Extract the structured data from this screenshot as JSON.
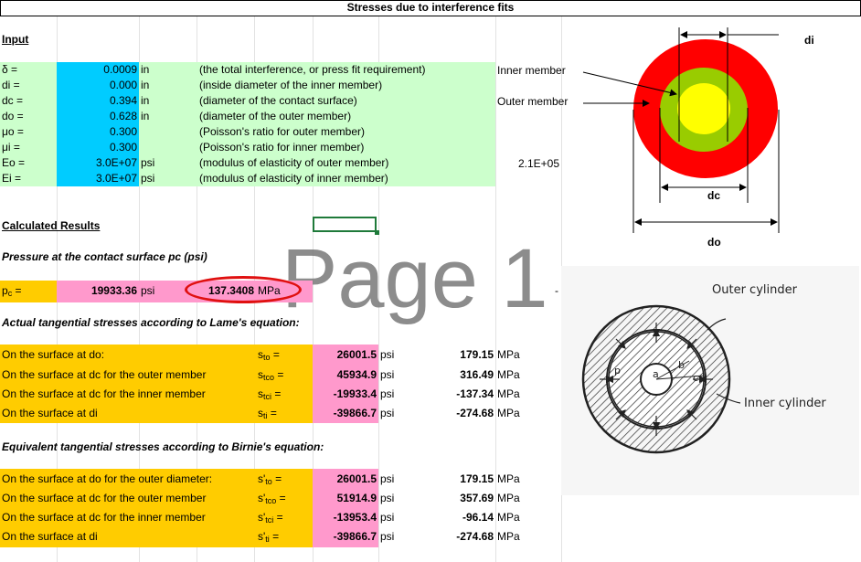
{
  "title": "Stresses due to interference fits",
  "watermark": "Page 1",
  "input": {
    "heading": "Input",
    "rows": [
      {
        "label": "δ =",
        "value": "0.0009",
        "unit": "in",
        "desc": "(the total interference, or press fit requirement)"
      },
      {
        "label": "di =",
        "value": "0.000",
        "unit": "in",
        "desc": "(inside diameter of the inner member)"
      },
      {
        "label": "dc =",
        "value": "0.394",
        "unit": "in",
        "desc": "(diameter of the contact surface)"
      },
      {
        "label": "do =",
        "value": "0.628",
        "unit": "in",
        "desc": "(diameter of the outer member)"
      },
      {
        "label": "μo =",
        "value": "0.300",
        "unit": "",
        "desc": "(Poisson's ratio for outer member)"
      },
      {
        "label": "μi =",
        "value": "0.300",
        "unit": "",
        "desc": "(Poisson's ratio for inner member)"
      },
      {
        "label": "Eo =",
        "value": "3.0E+07",
        "unit": "psi",
        "desc": "(modulus of elasticity of outer member)"
      },
      {
        "label": "Ei =",
        "value": "3.0E+07",
        "unit": "psi",
        "desc": "(modulus of elasticity of inner member)"
      }
    ],
    "inner_member_label": "Inner member",
    "outer_member_label": "Outer member",
    "extra_value": "2.1E+05"
  },
  "calculated": {
    "heading": "Calculated Results",
    "pressure_heading": "Pressure at the contact surface pc (psi)",
    "pc_label_main": "p",
    "pc_label_sub": "c",
    "pc_label_tail": " =",
    "pc_psi": "19933.36",
    "pc_psi_unit": "psi",
    "pc_mpa": "137.3408",
    "pc_mpa_unit": "MPa",
    "dash": "-"
  },
  "lame": {
    "heading": "Actual tangential stresses according to Lame's equation:",
    "rows": [
      {
        "desc": "On the surface at do:",
        "sym": "s",
        "sub": "to",
        "val": "26001.5",
        "unit": "psi",
        "mpa": "179.15",
        "mpa_unit": "MPa"
      },
      {
        "desc": "On the surface at dc for the outer member",
        "sym": "s",
        "sub": "tco",
        "val": "45934.9",
        "unit": "psi",
        "mpa": "316.49",
        "mpa_unit": "MPa"
      },
      {
        "desc": "On the surface at dc for the inner member",
        "sym": "s",
        "sub": "tci",
        "val": "-19933.4",
        "unit": "psi",
        "mpa": "-137.34",
        "mpa_unit": "MPa"
      },
      {
        "desc": "On the surface at di",
        "sym": "s",
        "sub": "ti",
        "val": "-39866.7",
        "unit": "psi",
        "mpa": "-274.68",
        "mpa_unit": "MPa"
      }
    ]
  },
  "birnie": {
    "heading": "Equivalent tangential stresses according to Birnie's equation:",
    "rows": [
      {
        "desc": "On the surface at do for the outer diameter:",
        "sym": "s'",
        "sub": "to",
        "val": "26001.5",
        "unit": "psi",
        "mpa": "179.15",
        "mpa_unit": "MPa"
      },
      {
        "desc": "On the surface at dc for the outer member",
        "sym": "s'",
        "sub": "tco",
        "val": "51914.9",
        "unit": "psi",
        "mpa": "357.69",
        "mpa_unit": "MPa"
      },
      {
        "desc": "On the surface at dc for the inner member",
        "sym": "s'",
        "sub": "tci",
        "val": "-13953.4",
        "unit": "psi",
        "mpa": "-96.14",
        "mpa_unit": "MPa"
      },
      {
        "desc": "On the surface at di",
        "sym": "s'",
        "sub": "ti",
        "val": "-39866.7",
        "unit": "psi",
        "mpa": "-274.68",
        "mpa_unit": "MPa"
      }
    ]
  },
  "diagram1": {
    "di": "di",
    "dc": "dc",
    "do": "do",
    "colors": {
      "outer": "#ff0000",
      "middle": "#99cc00",
      "inner": "#ffff00"
    }
  },
  "diagram2": {
    "outer_cylinder": "Outer cylinder",
    "inner_cylinder": "Inner cylinder",
    "a": "a",
    "b": "b",
    "c": "c",
    "p": "p"
  }
}
